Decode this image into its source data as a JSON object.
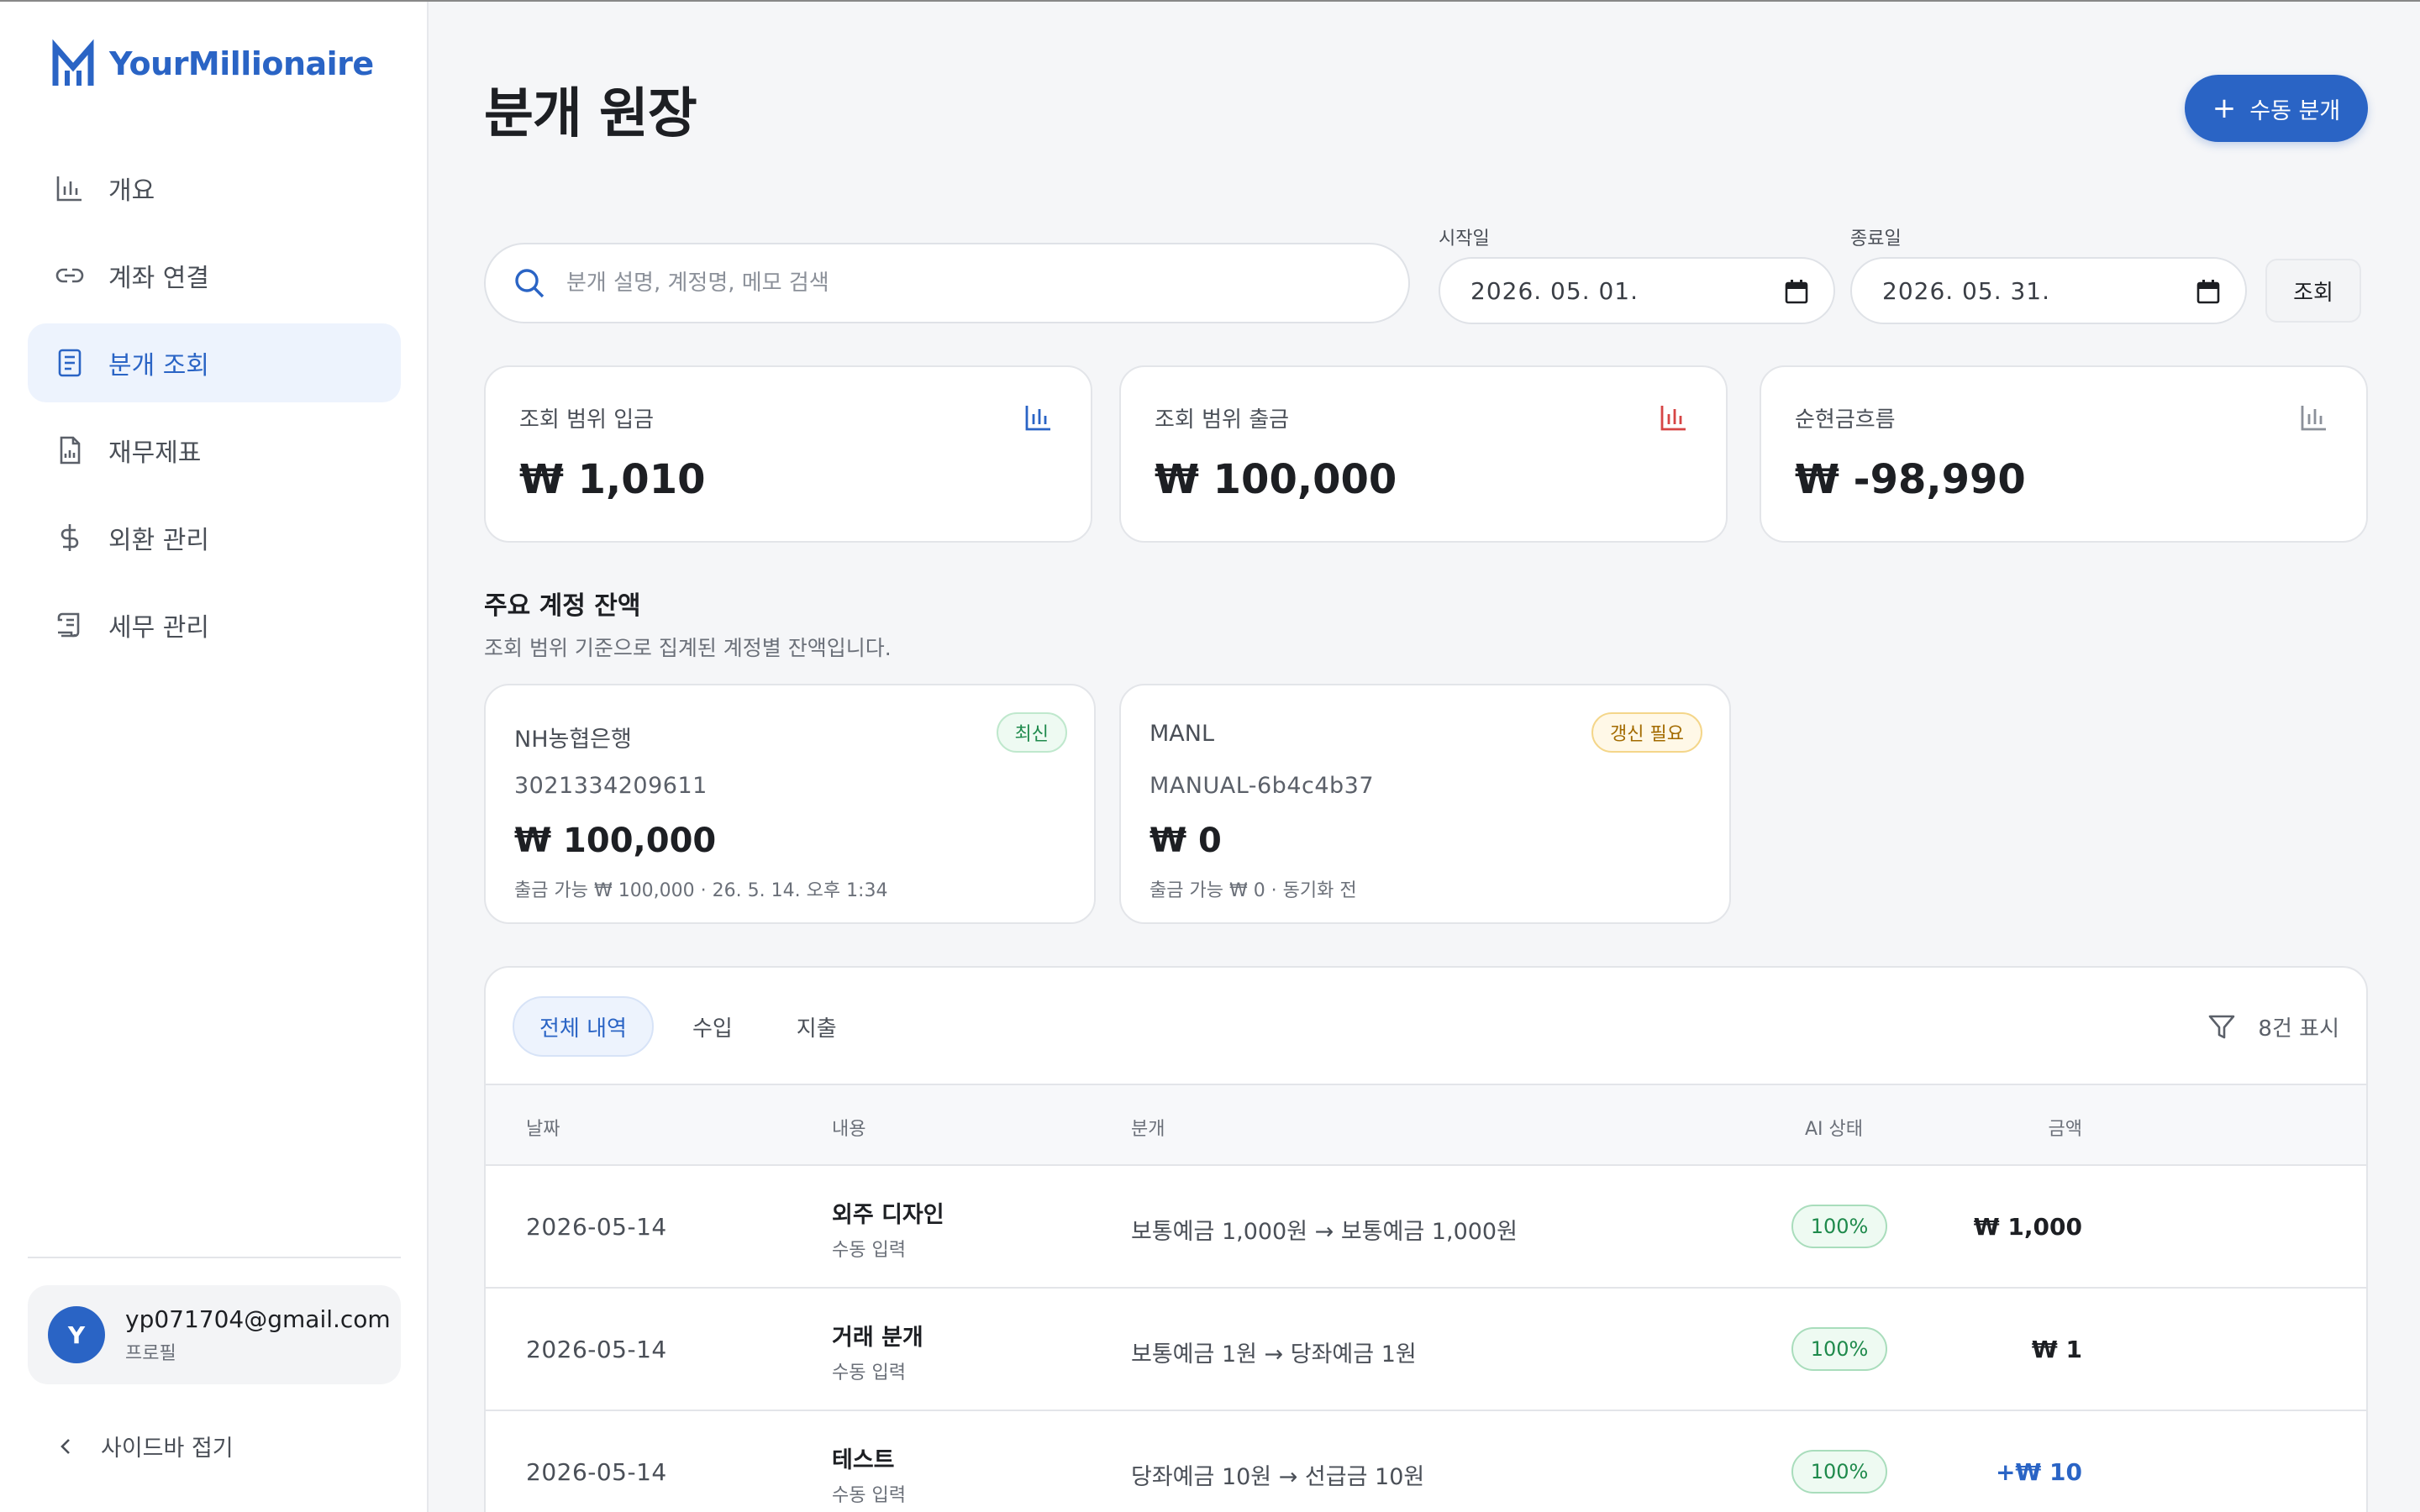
{
  "brand": {
    "name": "YourMillionaire",
    "color": "#2a64c5"
  },
  "sidebar": {
    "items": [
      {
        "label": "개요",
        "icon": "bar-chart-icon",
        "active": false
      },
      {
        "label": "계좌 연결",
        "icon": "link-icon",
        "active": false
      },
      {
        "label": "분개 조회",
        "icon": "document-list-icon",
        "active": true
      },
      {
        "label": "재무제표",
        "icon": "report-icon",
        "active": false
      },
      {
        "label": "외환 관리",
        "icon": "dollar-icon",
        "active": false
      },
      {
        "label": "세무 관리",
        "icon": "scroll-icon",
        "active": false
      }
    ],
    "profile": {
      "initial": "Y",
      "email": "yp071704@gmail.com",
      "sub": "프로필"
    },
    "collapse_label": "사이드바 접기"
  },
  "header": {
    "title": "분개 원장",
    "manual_button": "수동 분개"
  },
  "filters": {
    "search_placeholder": "분개 설명, 계정명, 메모 검색",
    "start_label": "시작일",
    "start_value": "2026. 05. 01.",
    "end_label": "종료일",
    "end_value": "2026. 05. 31.",
    "query_button": "조회"
  },
  "stats": [
    {
      "label": "조회 범위 입금",
      "value": "₩ 1,010",
      "icon_color": "#2a64c5"
    },
    {
      "label": "조회 범위 출금",
      "value": "₩ 100,000",
      "icon_color": "#d64545"
    },
    {
      "label": "순현금흐름",
      "value": "₩ -98,990",
      "icon_color": "#8b9099"
    }
  ],
  "balances": {
    "title": "주요 계정 잔액",
    "subtitle": "조회 범위 기준으로 집계된 계정별 잔액입니다.",
    "accounts": [
      {
        "name": "NH농협은행",
        "number": "3021334209611",
        "balance": "₩ 100,000",
        "meta": "출금 가능 ₩ 100,000 · 26. 5. 14. 오후 1:34",
        "badge": "최신"
      },
      {
        "name": "MANL",
        "number": "MANUAL-6b4c4b37",
        "balance": "₩ 0",
        "meta": "출금 가능 ₩ 0 · 동기화 전",
        "badge": "갱신 필요"
      }
    ]
  },
  "ledger": {
    "tabs": [
      "전체 내역",
      "수입",
      "지출"
    ],
    "count_label": "8건 표시",
    "columns": {
      "date": "날짜",
      "content": "내용",
      "entry": "분개",
      "amount": "금액",
      "ai": "AI 상태"
    },
    "rows": [
      {
        "date": "2026-05-14",
        "title": "외주 디자인",
        "sub": "수동 입력",
        "entry": "보통예금 1,000원 → 보통예금 1,000원",
        "amount": "₩ 1,000",
        "positive": false,
        "ai": "100%"
      },
      {
        "date": "2026-05-14",
        "title": "거래 분개",
        "sub": "수동 입력",
        "entry": "보통예금 1원 → 당좌예금 1원",
        "amount": "₩ 1",
        "positive": false,
        "ai": "100%"
      },
      {
        "date": "2026-05-14",
        "title": "테스트",
        "sub": "수동 입력",
        "entry": "당좌예금 10원 → 선급금 10원",
        "amount": "+₩ 10",
        "positive": true,
        "ai": "100%"
      }
    ]
  }
}
